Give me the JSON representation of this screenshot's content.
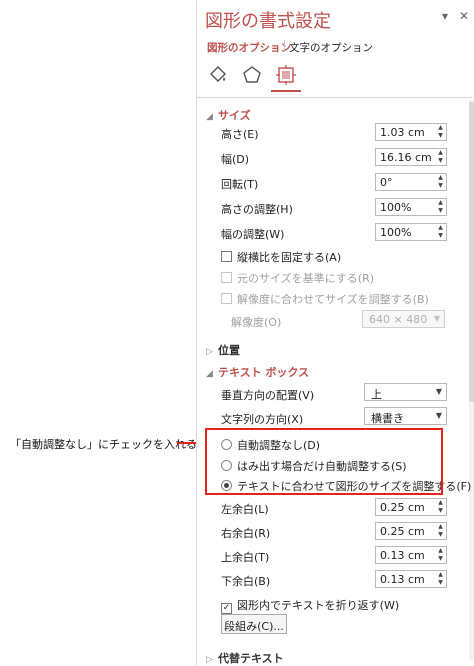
{
  "callout": {
    "text": "「自動調整なし」にチェックを入れる"
  },
  "pane": {
    "title": "図形の書式設定",
    "header_dropdown": "▾",
    "header_close": "✕",
    "tabs": [
      "図形のオプション",
      "文字のオプション"
    ],
    "icons": [
      "fill-line-icon",
      "effects-pentagon-icon",
      "size-properties-icon"
    ]
  },
  "size": {
    "header": "サイズ",
    "height_label": "高さ(E)",
    "height_value": "1.03 cm",
    "width_label": "幅(D)",
    "width_value": "16.16 cm",
    "rotation_label": "回転(T)",
    "rotation_value": "0°",
    "scale_height_label": "高さの調整(H)",
    "scale_height_value": "100%",
    "scale_width_label": "幅の調整(W)",
    "scale_width_value": "100%",
    "lock_aspect": "縦横比を固定する(A)",
    "relative_original": "元のサイズを基準にする(R)",
    "best_scale": "解像度に合わせてサイズを調整する(B)",
    "resolution_label": "解像度(O)",
    "resolution_value": "640 × 480"
  },
  "position": {
    "header": "位置"
  },
  "textbox": {
    "header": "テキスト ボックス",
    "valign_label": "垂直方向の配置(V)",
    "valign_value": "上",
    "direction_label": "文字列の方向(X)",
    "direction_value": "横書き",
    "autofit_options": [
      "自動調整なし(D)",
      "はみ出す場合だけ自動調整する(S)",
      "テキストに合わせて図形のサイズを調整する(F)"
    ],
    "autofit_selected_index": 2,
    "left_margin_label": "左余白(L)",
    "left_margin_value": "0.25 cm",
    "right_margin_label": "右余白(R)",
    "right_margin_value": "0.25 cm",
    "top_margin_label": "上余白(T)",
    "top_margin_value": "0.13 cm",
    "bottom_margin_label": "下余白(B)",
    "bottom_margin_value": "0.13 cm",
    "wrap_text": "図形内でテキストを折り返す(W)",
    "columns_button": "段組み(C)..."
  },
  "alt_text": {
    "header": "代替テキスト"
  },
  "colors": {
    "accent": "#c0504d",
    "highlight": "#e2241b"
  }
}
